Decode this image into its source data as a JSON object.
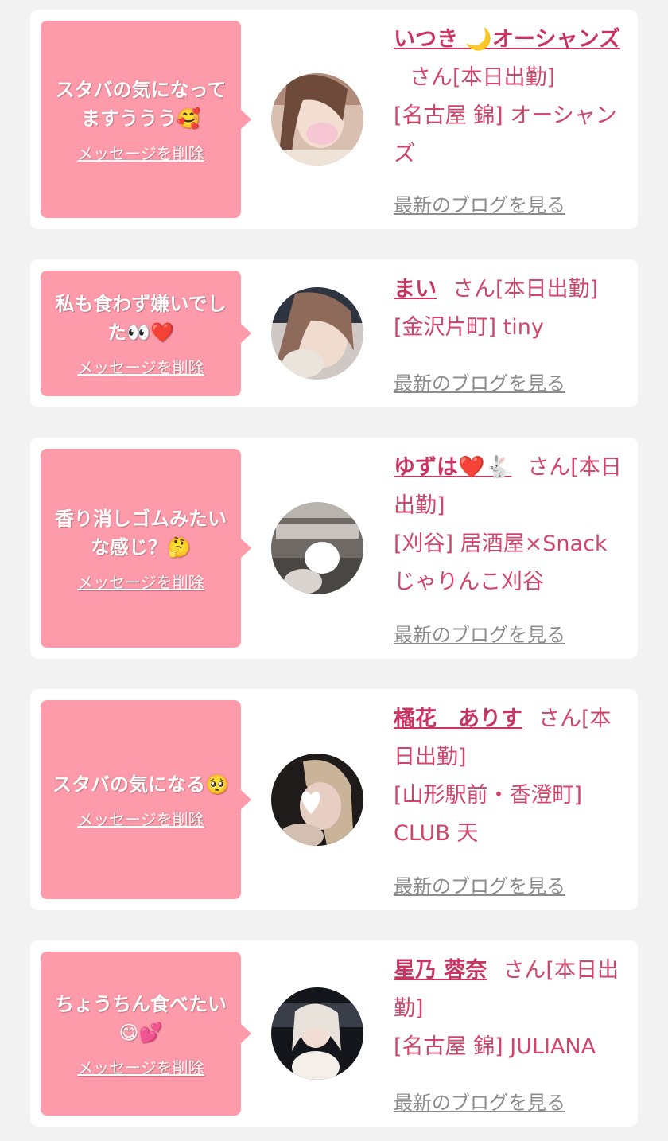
{
  "labels": {
    "delete": "メッセージを削除",
    "blog": "最新のブログを見る"
  },
  "cards": [
    {
      "message": "スタバの気になってますううう🥰",
      "name": "いつき 🌙オーシャンズ",
      "suffix": "さん[本日出勤]",
      "shop": "[名古屋 錦] オーシャンズ",
      "avatar_icon": "girl-photo-icon"
    },
    {
      "message": "私も食わず嫌いでした👀❤️",
      "name": "まい",
      "suffix": "さん[本日出勤]",
      "shop": "[金沢片町] tiny",
      "avatar_icon": "girl-photo-icon"
    },
    {
      "message": "香り消しゴムみたいな感じ？🤔",
      "name": "ゆずは❤️🐇",
      "suffix": "さん[本日出勤]",
      "shop": "[刈谷] 居酒屋×Snack じゃりんこ刈谷",
      "avatar_icon": "bus-photo-icon"
    },
    {
      "message": "スタバの気になる🥺",
      "name": "橘花　ありす",
      "suffix": "さん[本日出勤]",
      "shop": "[山形駅前・香澄町] CLUB 天",
      "avatar_icon": "girl-photo-icon"
    },
    {
      "message": "ちょうちん食べたい😋💕",
      "name": "星乃 蓉奈",
      "suffix": "さん[本日出勤]",
      "shop": "[名古屋 錦] JULIANA",
      "avatar_icon": "girl-photo-icon"
    }
  ]
}
